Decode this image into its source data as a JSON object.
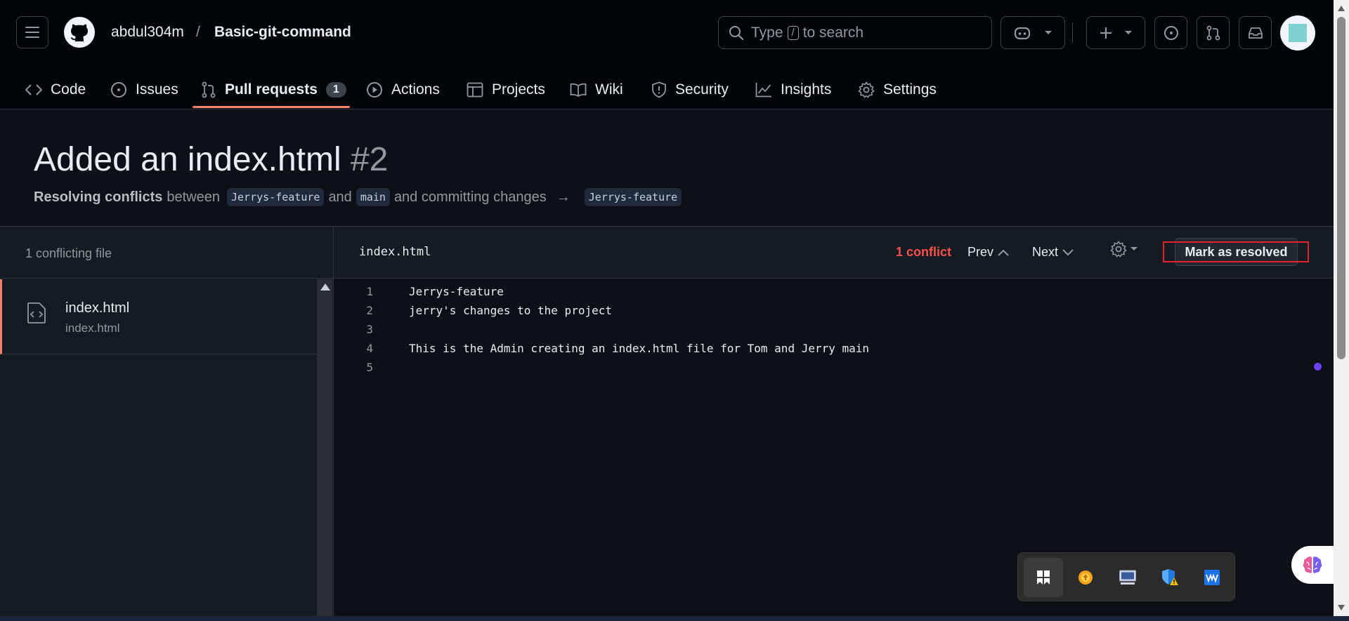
{
  "header": {
    "owner": "abdul304m",
    "separator": "/",
    "repo": "Basic-git-command",
    "search": {
      "prefix": "Type",
      "key": "/",
      "suffix": "to search"
    }
  },
  "tabs": [
    {
      "label": "Code",
      "icon": "code-icon"
    },
    {
      "label": "Issues",
      "icon": "issue-icon"
    },
    {
      "label": "Pull requests",
      "icon": "pull-request-icon",
      "count": "1",
      "active": true
    },
    {
      "label": "Actions",
      "icon": "play-icon"
    },
    {
      "label": "Projects",
      "icon": "table-icon"
    },
    {
      "label": "Wiki",
      "icon": "book-icon"
    },
    {
      "label": "Security",
      "icon": "shield-icon"
    },
    {
      "label": "Insights",
      "icon": "graph-icon"
    },
    {
      "label": "Settings",
      "icon": "gear-icon"
    }
  ],
  "pr": {
    "title": "Added an index.html",
    "number": "#2",
    "sub_bold": "Resolving conflicts",
    "sub_between": "between",
    "branch_head": "Jerrys-feature",
    "sub_and": "and",
    "branch_base": "main",
    "sub_commit": "and committing changes",
    "arrow": "→",
    "branch_target": "Jerrys-feature"
  },
  "sidebar": {
    "heading": "1 conflicting file",
    "file_name": "index.html",
    "file_path": "index.html"
  },
  "editor": {
    "file": "index.html",
    "conflicts": "1 conflict",
    "prev": "Prev",
    "next": "Next",
    "mark_resolved": "Mark as resolved",
    "lines": [
      {
        "n": "1",
        "text": "Jerrys-feature"
      },
      {
        "n": "2",
        "text": "jerry's changes to the project"
      },
      {
        "n": "3",
        "text": ""
      },
      {
        "n": "4",
        "text": "This is the Admin creating an index.html file for Tom and Jerry main"
      },
      {
        "n": "5",
        "text": ""
      }
    ]
  },
  "colors": {
    "accent_tab": "#f78166",
    "conflict": "#f85149",
    "background": "#0d1117"
  }
}
